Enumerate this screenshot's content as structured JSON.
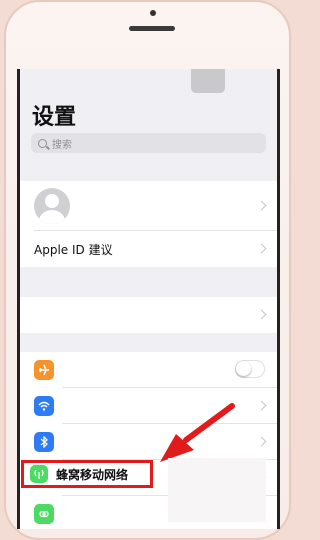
{
  "settings": {
    "title": "设置",
    "search_placeholder": "搜索"
  },
  "account": {
    "apple_id_suggestion": "Apple ID 建议"
  },
  "network": {
    "cellular_label": "蜂窝移动网络"
  },
  "colors": {
    "airplane": "#f7932b",
    "wifi": "#2d7cf6",
    "bluetooth": "#2d7cf6",
    "cellular": "#4cd964",
    "hotspot": "#4cd964",
    "annotation": "#e11b1b"
  },
  "icons": [
    "airplane-icon",
    "wifi-icon",
    "bluetooth-icon",
    "cellular-icon",
    "hotspot-icon",
    "search-icon"
  ]
}
